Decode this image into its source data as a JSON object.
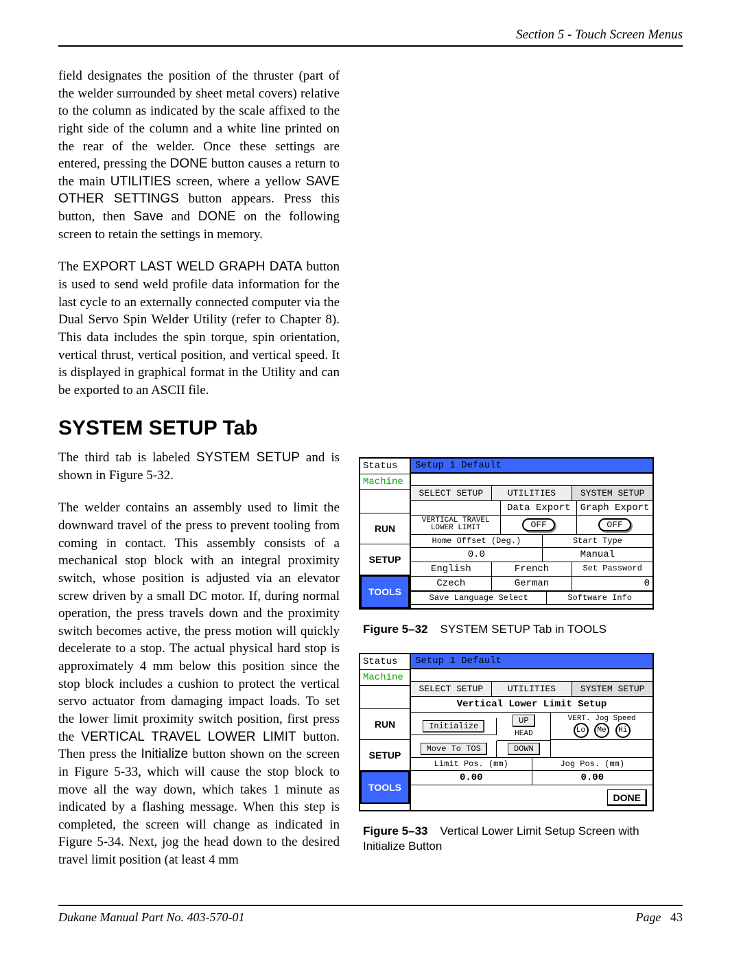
{
  "header": {
    "section": "Section 5 - Touch Screen Menus"
  },
  "body": {
    "p1": "field designates the position of the thruster (part of the welder surrounded by sheet metal covers) relative to the column as indicated by the scale affixed to the right side of the column and a white line printed on the rear of the welder.  Once these settings are entered, pressing the ",
    "p1_done": "DONE",
    "p1b": " button causes a return to the main ",
    "p1_util": "UTILITIES",
    "p1c": " screen, where a yellow ",
    "p1_save": "SAVE OTHER SETTINGS",
    "p1d": " button appears.  Press this button, then ",
    "p1_save2": "Save",
    "p1e": " and ",
    "p1_done2": "DONE",
    "p1f": " on the following screen to retain the settings in memory.",
    "p2a": "The ",
    "p2_btn": "EXPORT LAST WELD GRAPH DATA",
    "p2b": " button is used to send weld profile data information for the last cycle to an externally connected computer via the Dual Servo Spin Welder Utility (refer to Chapter 8). This data includes the spin torque, spin orientation, vertical thrust, vertical position, and vertical speed.  It is displayed in graphical format in the Utility and can be exported to an ASCII file.",
    "h2": "SYSTEM SETUP Tab",
    "p3a": "The third tab is labeled ",
    "p3_sys": "SYSTEM SETUP",
    "p3b": " and is shown in Figure 5-32.",
    "p4a": "The welder contains an assembly used to limit the downward travel of the press to prevent tooling from coming in contact. This assembly consists of a mechanical stop block with an integral proximity switch, whose position is adjusted via an elevator screw driven by a small DC motor. If, during normal operation, the press travels down and the proximity switch becomes active, the press motion will quickly decelerate to a stop. The actual physical hard stop is approximately 4 mm below this position since the stop block includes a cushion to protect the vertical servo actuator from damaging impact loads. To set the lower limit proximity switch position, first press the ",
    "p4_vtl": "VERTICAL TRAVEL LOWER LIMIT",
    "p4b": " button. Then press the ",
    "p4_init": "Initialize",
    "p4c": " button shown on the screen in Figure 5-33, which will cause the stop block to move all the way down, which takes 1 minute as indicated by a flashing message. When this step is completed, the screen will change as indicated in Figure 5-34. Next, jog the head down to the desired travel limit position (at least 4 mm"
  },
  "fig32": {
    "status": "Status",
    "machine": "Machine",
    "run": "RUN",
    "setup": "SETUP",
    "tools": "TOOLS",
    "title": "Setup 1   Default",
    "tabs": {
      "a": "SELECT SETUP",
      "b": "UTILITIES",
      "c": "SYSTEM SETUP"
    },
    "dataExport": "Data Export",
    "graphExport": "Graph Export",
    "vtll": "VERTICAL TRAVEL\nLOWER LIMIT",
    "off": "OFF",
    "homeOffset": "Home Offset (Deg.)",
    "homeVal": "0.0",
    "startType": "Start Type",
    "manual": "Manual",
    "lang": {
      "en": "English",
      "fr": "French",
      "cz": "Czech",
      "de": "German"
    },
    "setPwd": "Set Password",
    "pwdVal": "0",
    "saveLang": "Save Language Select",
    "swInfo": "Software Info",
    "caption_lbl": "Figure 5–32",
    "caption_txt": "SYSTEM SETUP Tab in TOOLS"
  },
  "fig33": {
    "status": "Status",
    "machine": "Machine",
    "run": "RUN",
    "setup": "SETUP",
    "tools": "TOOLS",
    "title": "Setup 1   Default",
    "tabs": {
      "a": "SELECT SETUP",
      "b": "UTILITIES",
      "c": "SYSTEM SETUP"
    },
    "heading": "Vertical Lower Limit Setup",
    "initialize": "Initialize",
    "up": "UP",
    "head": "HEAD",
    "down": "DOWN",
    "moveTos": "Move To TOS",
    "jogSpeed": "VERT. Jog Speed",
    "lo": "Lo",
    "me": "Me",
    "hi": "Hi",
    "limitPos": "Limit Pos. (mm)",
    "jogPos": "Jog Pos. (mm)",
    "zero": "0.00",
    "done": "DONE",
    "caption_lbl": "Figure 5–33",
    "caption_txt": "Vertical Lower Limit Setup Screen with Initialize Button"
  },
  "footer": {
    "left": "Dukane Manual Part No. 403-570-01",
    "right_lbl": "Page",
    "right_num": "43"
  }
}
